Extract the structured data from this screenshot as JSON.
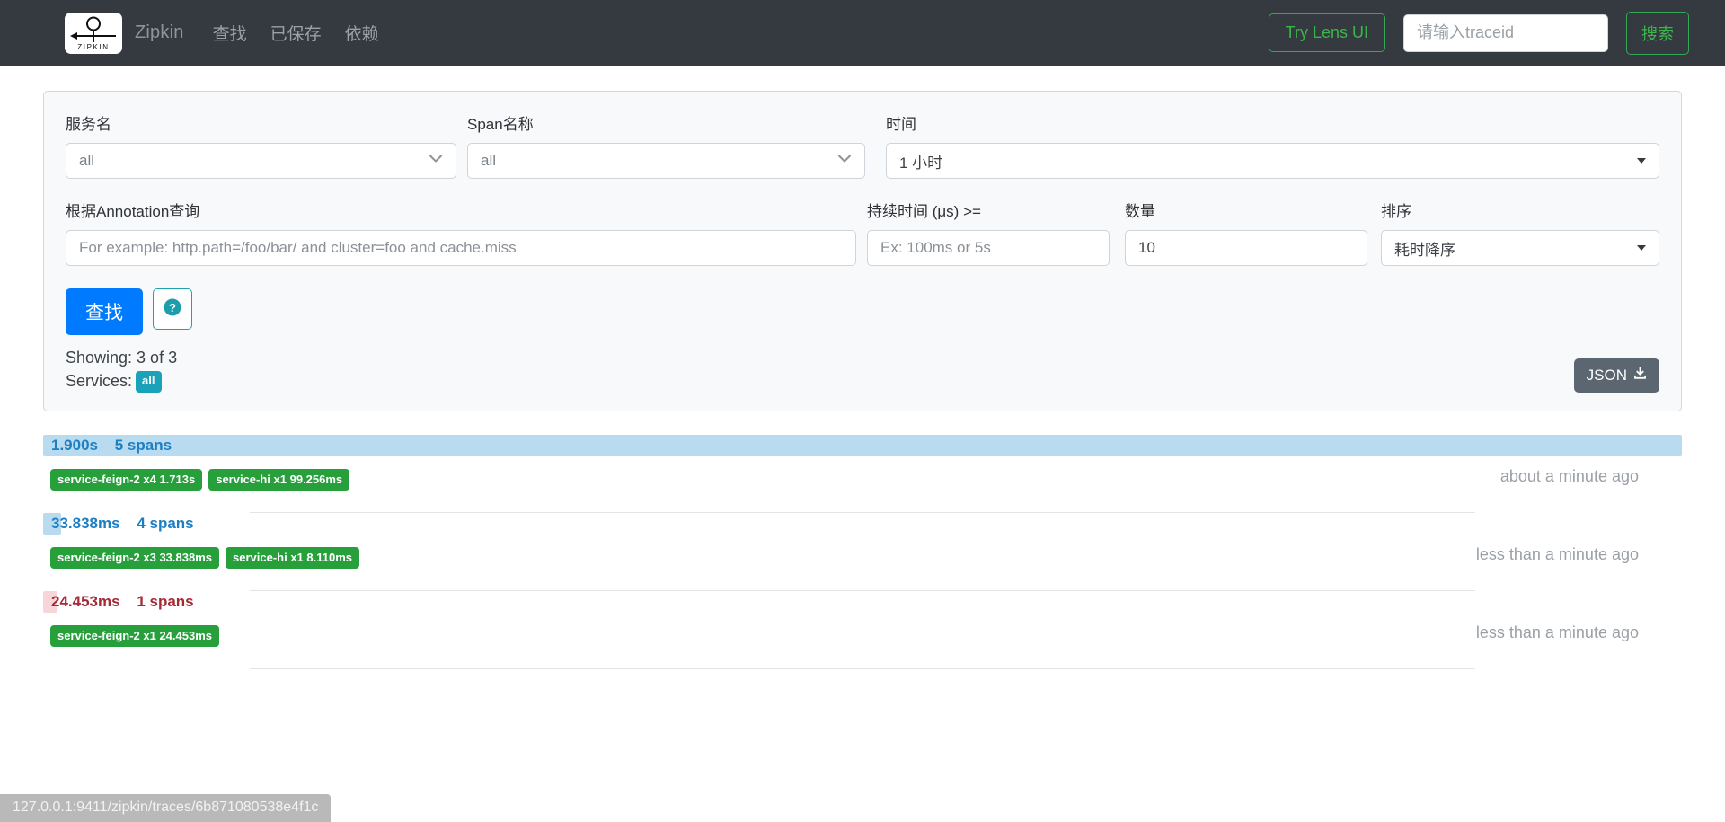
{
  "navbar": {
    "logo_icon": "zipkin-logo-icon",
    "logo_text": "ZIPKIN",
    "brand": "Zipkin",
    "links": [
      {
        "label": "查找"
      },
      {
        "label": "已保存"
      },
      {
        "label": "依赖"
      }
    ],
    "lens_button": "Try Lens UI",
    "traceid_placeholder": "请输入traceid",
    "traceid_value": "",
    "search_button": "搜索",
    "background_color": "#343a40"
  },
  "search_panel": {
    "service": {
      "label": "服务名",
      "value": "all"
    },
    "span": {
      "label": "Span名称",
      "value": "all"
    },
    "time": {
      "label": "时间",
      "value": "1 小时"
    },
    "annotation": {
      "label": "根据Annotation查询",
      "value": "",
      "placeholder": "For example: http.path=/foo/bar/ and cluster=foo and cache.miss"
    },
    "duration": {
      "label": "持续时间 (μs) >=",
      "value": "",
      "placeholder": "Ex: 100ms or 5s"
    },
    "limit": {
      "label": "数量",
      "value": "10"
    },
    "sort": {
      "label": "排序",
      "value": "耗时降序"
    },
    "find_button": "查找",
    "help_icon": "question-circle-icon",
    "showing": "Showing: 3 of 3",
    "services_label": "Services:",
    "services_badge": "all",
    "json_button": "JSON",
    "json_icon": "download-icon",
    "accent_color": "#007bff",
    "badge_color": "#1aa2b8"
  },
  "results": [
    {
      "duration": "1.900s",
      "spans": "5 spans",
      "bar_width_pct": 100,
      "state": "ok",
      "services": [
        "service-feign-2 x4 1.713s",
        "service-hi x1 99.256ms"
      ],
      "timestamp": "about a minute ago"
    },
    {
      "duration": "33.838ms",
      "spans": "4 spans",
      "bar_width_pct": 1.1,
      "state": "ok",
      "services": [
        "service-feign-2 x3 33.838ms",
        "service-hi x1 8.110ms"
      ],
      "timestamp": "less than a minute ago"
    },
    {
      "duration": "24.453ms",
      "spans": "1 spans",
      "bar_width_pct": 0.85,
      "state": "error",
      "services": [
        "service-feign-2 x1 24.453ms"
      ],
      "timestamp": "less than a minute ago"
    }
  ],
  "statusbar": {
    "url": "127.0.0.1:9411/zipkin/traces/6b871080538e4f1c"
  }
}
